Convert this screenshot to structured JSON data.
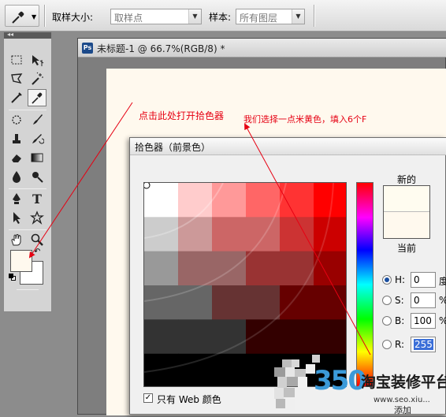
{
  "options_bar": {
    "sample_size_label": "取样大小:",
    "sample_size_value": "取样点",
    "sample_label": "样本:",
    "sample_value": "所有图层"
  },
  "document": {
    "title": "未标题-1 @ 66.7%(RGB/8) *",
    "ps_icon_text": "Ps",
    "canvas_color": "#fff9ee"
  },
  "annotations": {
    "click_here": "点击此处打开拾色器",
    "instruction": "我们选择一点米黄色，填入6个F"
  },
  "color_picker": {
    "title": "拾色器（前景色）",
    "new_label": "新的",
    "current_label": "当前",
    "fields": [
      {
        "label": "H:",
        "value": "0",
        "unit": "度",
        "selected": true
      },
      {
        "label": "S:",
        "value": "0",
        "unit": "%",
        "selected": false
      },
      {
        "label": "B:",
        "value": "100",
        "unit": "%",
        "selected": false
      },
      {
        "label": "R:",
        "value": "255",
        "unit": "",
        "selected": false
      }
    ],
    "web_only_label": "只有 Web 颜色",
    "web_only_checked": true,
    "new_color": "#fffcf0",
    "current_color": "#fff9ee"
  },
  "tools": {
    "foreground_color": "#fff9ee",
    "background_color": "#ffffff"
  },
  "watermark": {
    "number": "350",
    "brand": "淘宝装修平台",
    "url": "www.seo.xiu...",
    "partial_text": "添加"
  }
}
